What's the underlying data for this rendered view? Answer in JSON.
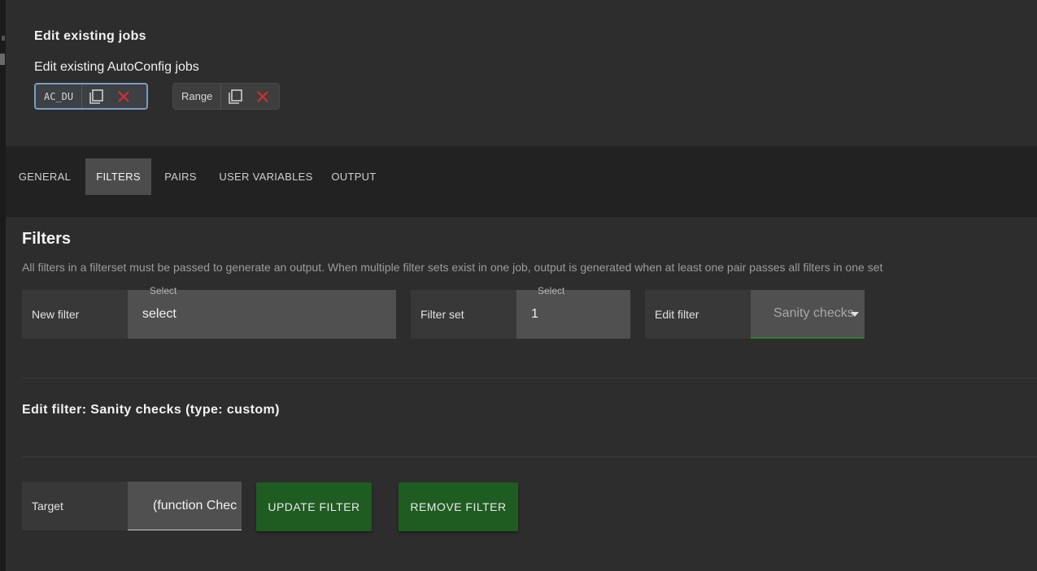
{
  "header": {
    "title": "Edit existing jobs",
    "subtitle": "Edit existing AutoConfig jobs"
  },
  "jobs": [
    {
      "label": "AC_DU",
      "selected": true
    },
    {
      "label": "Range",
      "selected": false
    }
  ],
  "tabs": [
    {
      "label": "GENERAL",
      "active": false
    },
    {
      "label": "FILTERS",
      "active": true
    },
    {
      "label": "PAIRS",
      "active": false
    },
    {
      "label": "USER VARIABLES",
      "active": false
    },
    {
      "label": "OUTPUT",
      "active": false
    }
  ],
  "filters": {
    "title": "Filters",
    "description": "All filters in a filterset must be passed to generate an output. When multiple filter sets exist in one job, output is generated when at least one pair passes all filters in one set",
    "new_filter": {
      "label": "New filter",
      "float_label": "Select",
      "value": "select"
    },
    "filter_set": {
      "label": "Filter set",
      "float_label": "Select",
      "value": "1"
    },
    "edit_filter": {
      "label": "Edit filter",
      "value": "Sanity checks"
    },
    "edit_heading": "Edit filter: Sanity checks (type: custom)",
    "target": {
      "label": "Target",
      "value": "(function Chec"
    },
    "update_button": "UPDATE FILTER",
    "remove_button": "REMOVE FILTER"
  },
  "colors": {
    "background": "#2d2d2d",
    "tabbar": "#222222",
    "active_tab": "#4c4c4c",
    "button_green": "#1f5c22",
    "close_red": "#d32f2f",
    "selected_border": "#7a9cc4",
    "underline_green": "#2e7d32"
  }
}
